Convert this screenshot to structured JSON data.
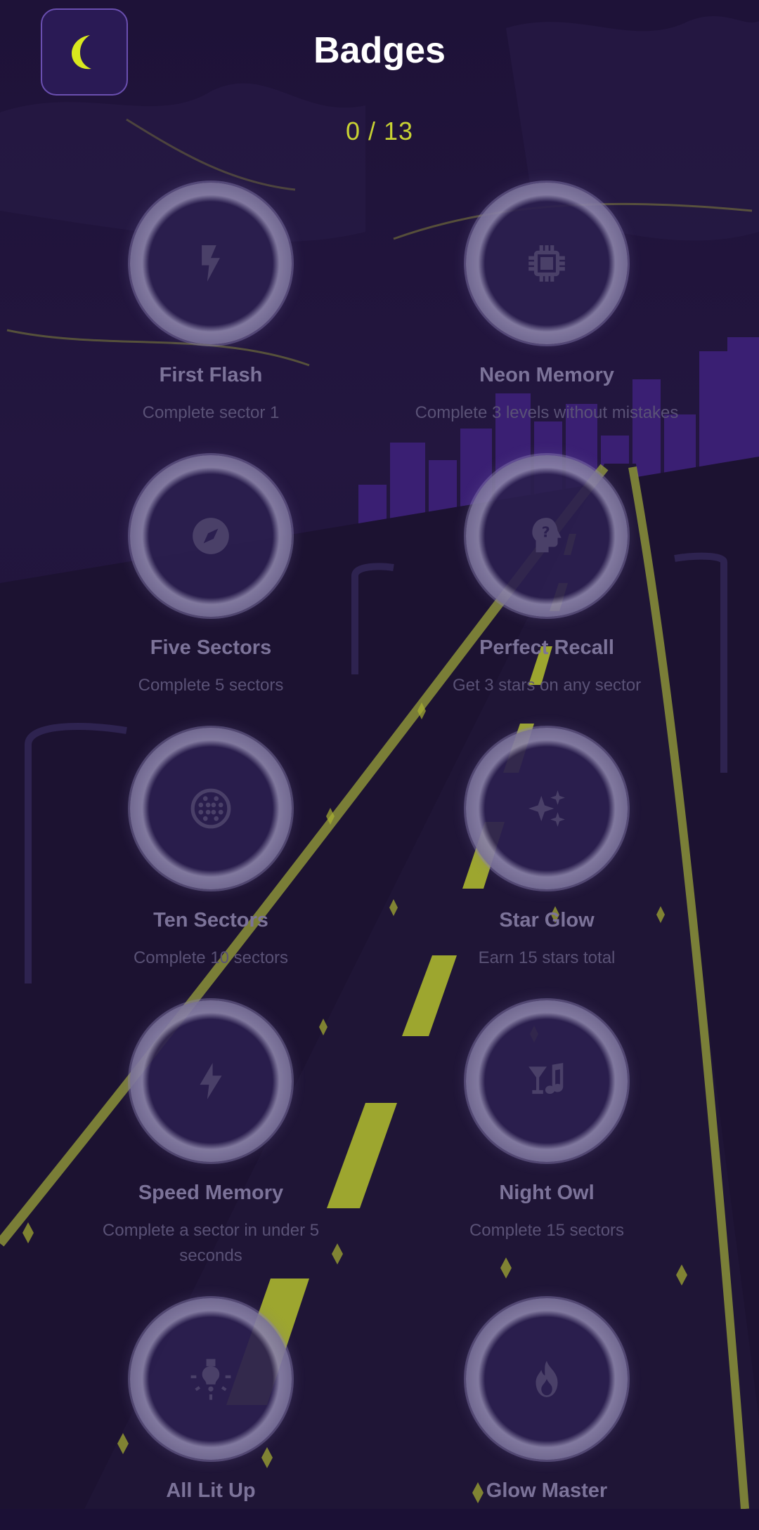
{
  "header": {
    "title": "Badges",
    "progress": "0 / 13",
    "back_icon": "moon-icon"
  },
  "colors": {
    "accent": "#c8d233",
    "background": "#1b1035",
    "locked_text": "#7c7399"
  },
  "badges": [
    {
      "name": "First Flash",
      "description": "Complete sector 1",
      "icon": "lightning-bolt-icon",
      "locked": true
    },
    {
      "name": "Neon Memory",
      "description": "Complete 3 levels without mistakes",
      "icon": "chip-icon",
      "locked": true
    },
    {
      "name": "Five Sectors",
      "description": "Complete 5 sectors",
      "icon": "compass-icon",
      "locked": true
    },
    {
      "name": "Perfect Recall",
      "description": "Get 3 stars on any sector",
      "icon": "head-question-icon",
      "locked": true
    },
    {
      "name": "Ten Sectors",
      "description": "Complete 10 sectors",
      "icon": "dots-grid-circle-icon",
      "locked": true
    },
    {
      "name": "Star Glow",
      "description": "Earn 15 stars total",
      "icon": "sparkles-icon",
      "locked": true
    },
    {
      "name": "Speed Memory",
      "description": "Complete a sector in under 5 seconds",
      "icon": "flash-icon",
      "locked": true
    },
    {
      "name": "Night Owl",
      "description": "Complete 15 sectors",
      "icon": "cocktail-music-icon",
      "locked": true
    },
    {
      "name": "All Lit Up",
      "description": "",
      "icon": "lightbulb-icon",
      "locked": true
    },
    {
      "name": "Glow Master",
      "description": "",
      "icon": "flame-icon",
      "locked": true
    }
  ]
}
